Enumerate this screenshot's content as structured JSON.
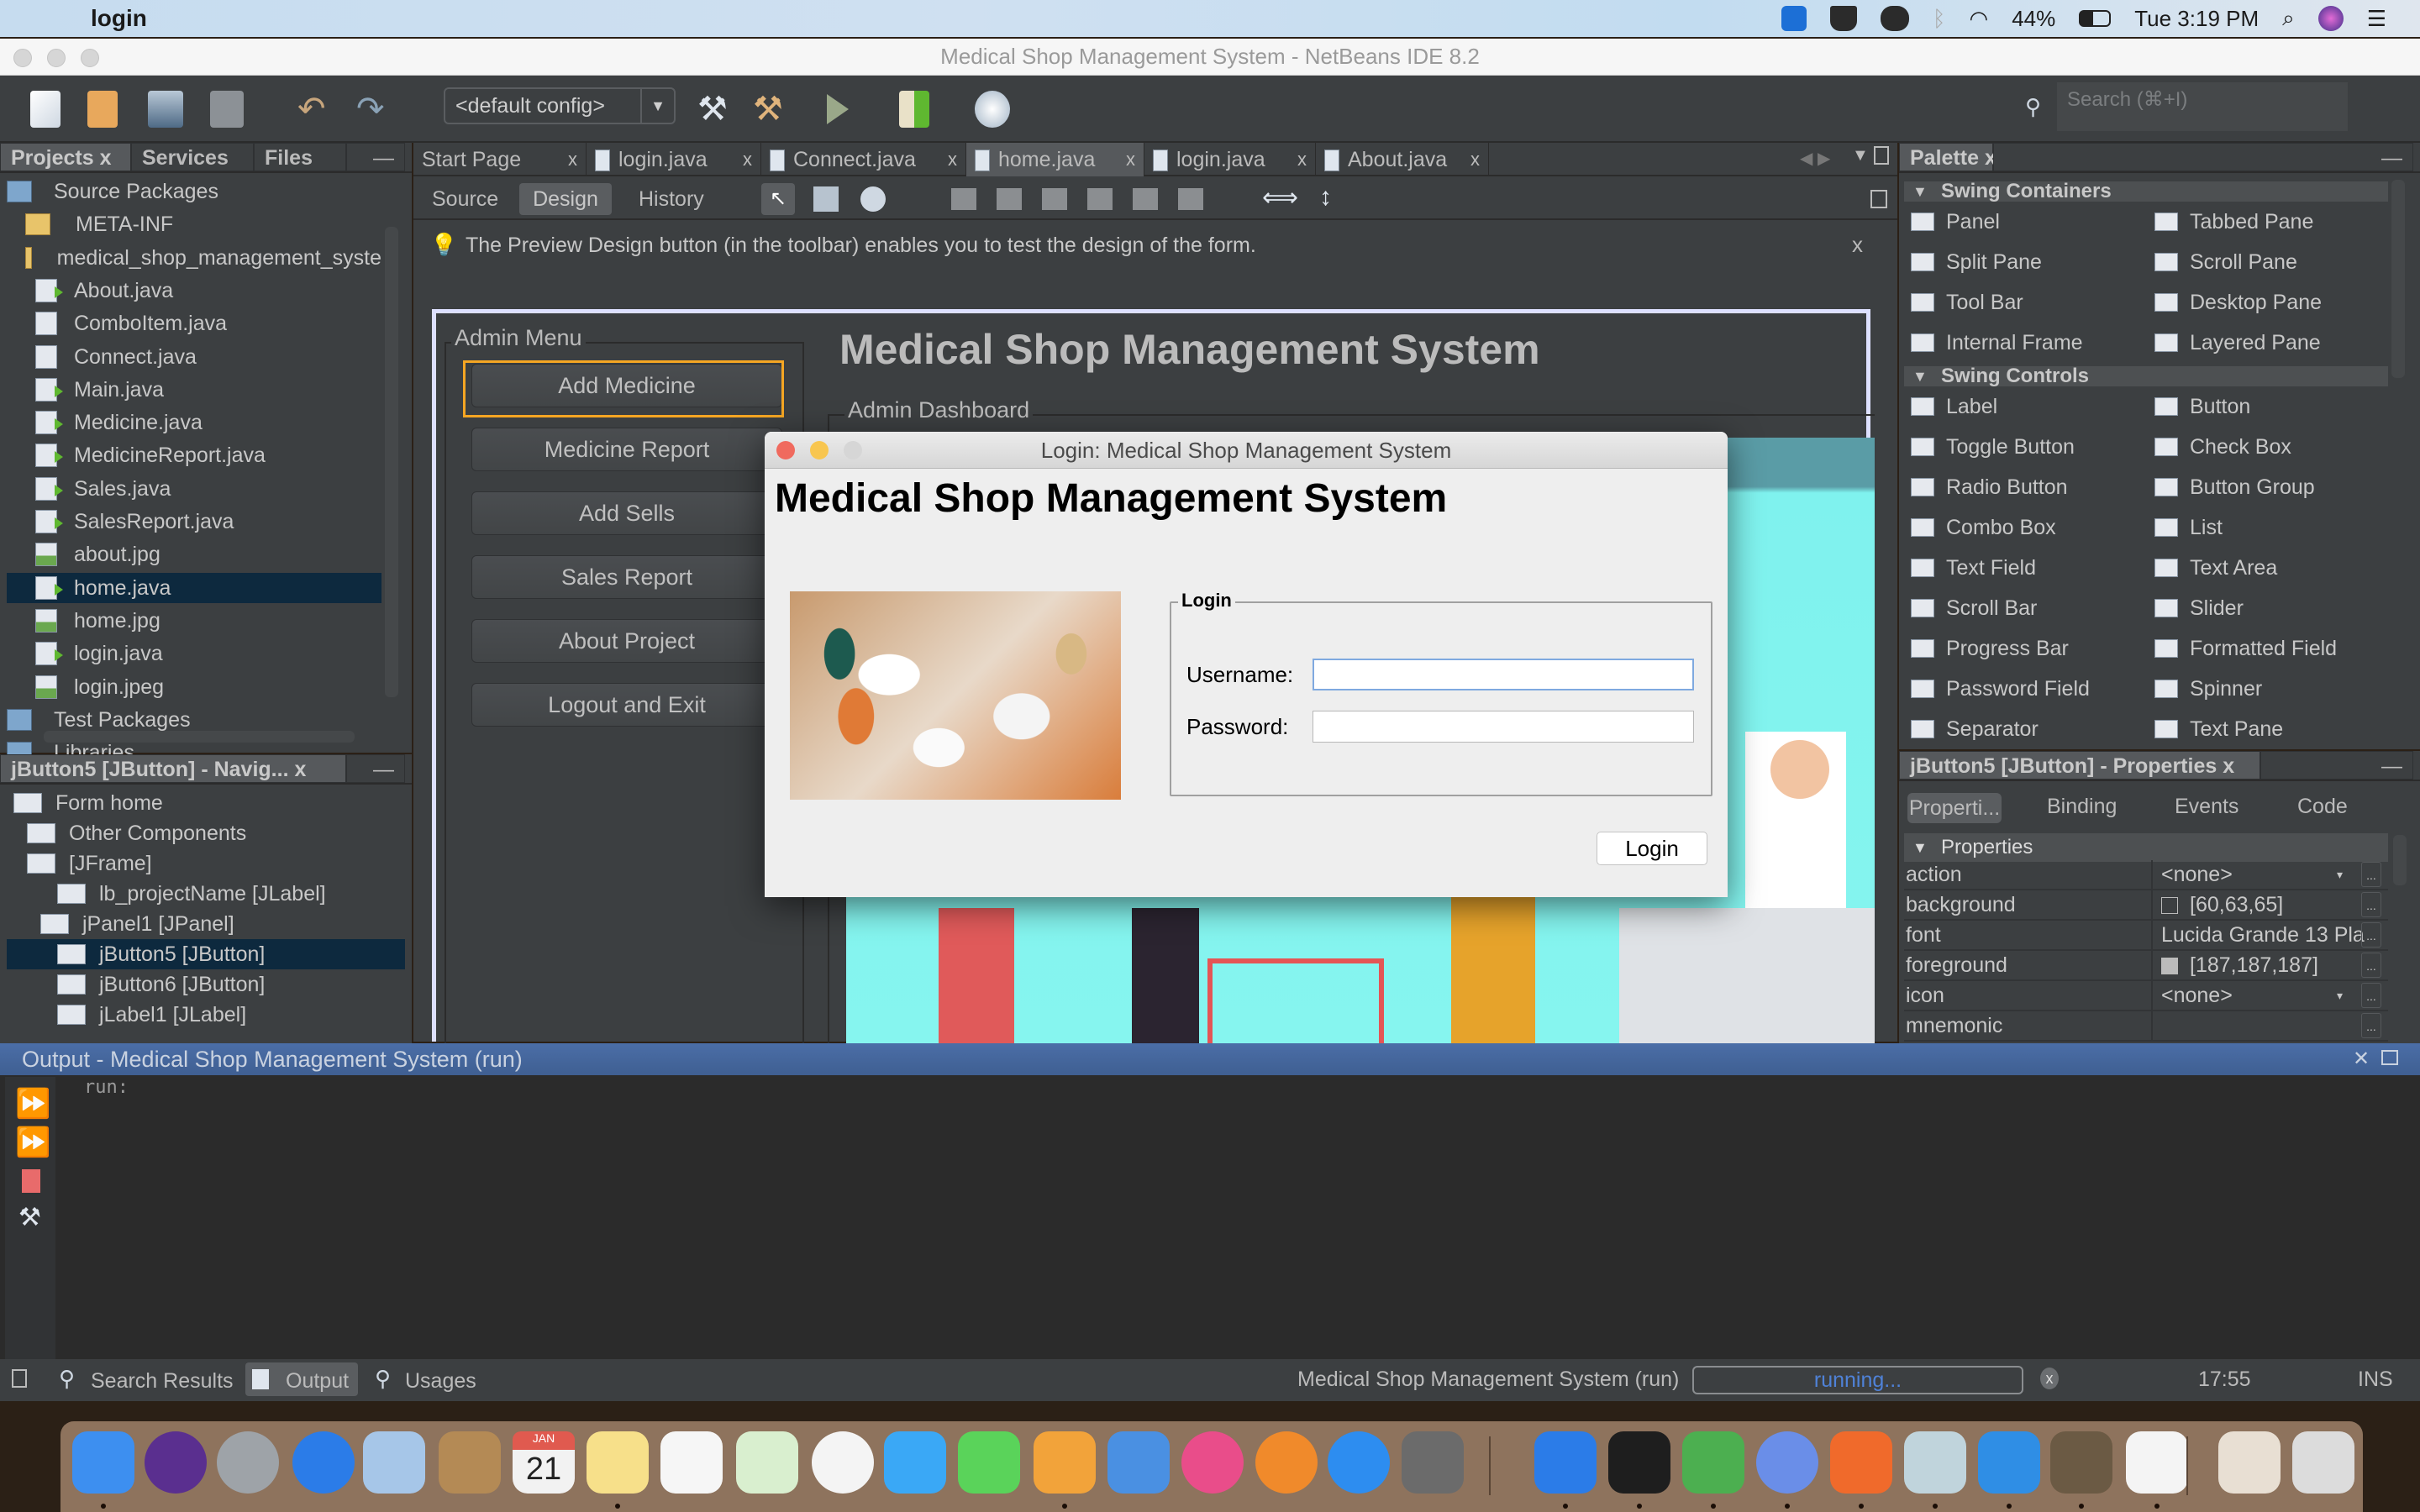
{
  "menubar": {
    "app_name": "login",
    "battery": "44%",
    "clock": "Tue 3:19 PM",
    "icons": [
      "apple-icon",
      "teamviewer-icon",
      "docker-icon",
      "cloud-upload-icon",
      "bluetooth-icon",
      "wifi-icon",
      "battery-icon",
      "spotlight-search-icon",
      "siri-icon",
      "notification-center-icon"
    ]
  },
  "window": {
    "title": "Medical Shop Management System - NetBeans IDE 8.2"
  },
  "toolbar": {
    "config_value": "<default config>",
    "search_placeholder": "Search (⌘+I)",
    "icons": [
      "new-file-icon",
      "new-project-icon",
      "open-project-icon",
      "save-all-icon",
      "undo-icon",
      "redo-icon",
      "build-icon",
      "clean-build-icon",
      "run-icon",
      "debug-icon",
      "profile-icon"
    ]
  },
  "projects_panel": {
    "tabs": [
      "Projects",
      "Services",
      "Files"
    ],
    "close": "x",
    "tree": [
      {
        "label": "Source Packages",
        "type": "root"
      },
      {
        "label": "META-INF",
        "type": "package"
      },
      {
        "label": "medical_shop_management_syste",
        "type": "package"
      },
      {
        "label": "About.java",
        "type": "java"
      },
      {
        "label": "ComboItem.java",
        "type": "class"
      },
      {
        "label": "Connect.java",
        "type": "class"
      },
      {
        "label": "Main.java",
        "type": "java"
      },
      {
        "label": "Medicine.java",
        "type": "java"
      },
      {
        "label": "MedicineReport.java",
        "type": "java"
      },
      {
        "label": "Sales.java",
        "type": "java"
      },
      {
        "label": "SalesReport.java",
        "type": "java"
      },
      {
        "label": "about.jpg",
        "type": "image"
      },
      {
        "label": "home.java",
        "type": "java",
        "selected": true
      },
      {
        "label": "home.jpg",
        "type": "image"
      },
      {
        "label": "login.java",
        "type": "java"
      },
      {
        "label": "login.jpeg",
        "type": "image"
      },
      {
        "label": "Test Packages",
        "type": "root"
      },
      {
        "label": "Libraries",
        "type": "root"
      }
    ]
  },
  "navigator_panel": {
    "title": "jButton5 [JButton] - Navig...",
    "tree": [
      {
        "label": "Form home"
      },
      {
        "label": "Other Components"
      },
      {
        "label": "[JFrame]"
      },
      {
        "label": "lb_projectName [JLabel]"
      },
      {
        "label": "jPanel1 [JPanel]"
      },
      {
        "label": "jButton5 [JButton]",
        "selected": true
      },
      {
        "label": "jButton6 [JButton]"
      },
      {
        "label": "jLabel1 [JLabel]"
      }
    ]
  },
  "editor": {
    "tabs": [
      {
        "label": "Start Page"
      },
      {
        "label": "login.java"
      },
      {
        "label": "Connect.java"
      },
      {
        "label": "home.java",
        "active": true
      },
      {
        "label": "login.java"
      },
      {
        "label": "About.java"
      }
    ],
    "subtabs": [
      "Source",
      "Design",
      "History"
    ],
    "active_subtab": "Design",
    "info_message": "The Preview Design button (in the toolbar) enables you to test the design of the form.",
    "info_close": "x"
  },
  "form_design": {
    "admin_menu_label": "Admin Menu",
    "title": "Medical Shop Management System",
    "dashboard_label": "Admin Dashboard",
    "buttons": [
      "Add Medicine",
      "Medicine Report",
      "Add Sells",
      "Sales Report",
      "About Project",
      "Logout and Exit"
    ],
    "selected_button": "Add Medicine"
  },
  "login_dialog": {
    "title": "Login: Medical Shop Management System",
    "heading": "Medical Shop Management System",
    "group_label": "Login",
    "username_label": "Username:",
    "username_value": "",
    "password_label": "Password:",
    "password_value": "",
    "login_button": "Login"
  },
  "palette": {
    "title": "Palette",
    "sections": [
      {
        "name": "Swing Containers",
        "items": [
          "Panel",
          "Tabbed Pane",
          "Split Pane",
          "Scroll Pane",
          "Tool Bar",
          "Desktop Pane",
          "Internal Frame",
          "Layered Pane"
        ]
      },
      {
        "name": "Swing Controls",
        "items": [
          "Label",
          "Button",
          "Toggle Button",
          "Check Box",
          "Radio Button",
          "Button Group",
          "Combo Box",
          "List",
          "Text Field",
          "Text Area",
          "Scroll Bar",
          "Slider",
          "Progress Bar",
          "Formatted Field",
          "Password Field",
          "Spinner",
          "Separator",
          "Text Pane"
        ]
      }
    ]
  },
  "properties_panel": {
    "title": "jButton5 [JButton] - Properties",
    "tabs": [
      "Properti...",
      "Binding",
      "Events",
      "Code"
    ],
    "section": "Properties",
    "rows": [
      {
        "key": "action",
        "value": "<none>",
        "dropdown": true
      },
      {
        "key": "background",
        "value": "[60,63,65]",
        "swatch": "#3c3f41"
      },
      {
        "key": "font",
        "value": "Lucida Grande 13 Pla"
      },
      {
        "key": "foreground",
        "value": "[187,187,187]",
        "swatch": "#bbbbbb"
      },
      {
        "key": "icon",
        "value": "<none>",
        "dropdown": true
      },
      {
        "key": "mnemonic",
        "value": ""
      }
    ]
  },
  "output": {
    "title": "Output - Medical Shop Management System (run)",
    "text": "run:"
  },
  "statusbar": {
    "tabs": [
      "Search Results",
      "Output",
      "Usages"
    ],
    "active_tab": "Output",
    "task": "Medical Shop Management System (run)",
    "progress_text": "running...",
    "position": "17:55",
    "mode": "INS"
  },
  "dock": {
    "apps": [
      "Finder",
      "Siri",
      "Launchpad",
      "Safari",
      "Mail",
      "Contacts",
      "Calendar",
      "Notes",
      "Reminders",
      "Maps",
      "Photos",
      "Messages",
      "FaceTime",
      "Pages",
      "Keynote",
      "iTunes",
      "iBooks",
      "App Store",
      "System Preferences",
      "TeamViewer",
      "Terminal",
      "Chrome",
      "Chromium",
      "Firefox",
      "VirtualBox",
      "VS Code",
      "GIMP",
      "Java",
      "Downloads",
      "Trash"
    ],
    "calendar_month": "JAN",
    "calendar_day": "21"
  }
}
